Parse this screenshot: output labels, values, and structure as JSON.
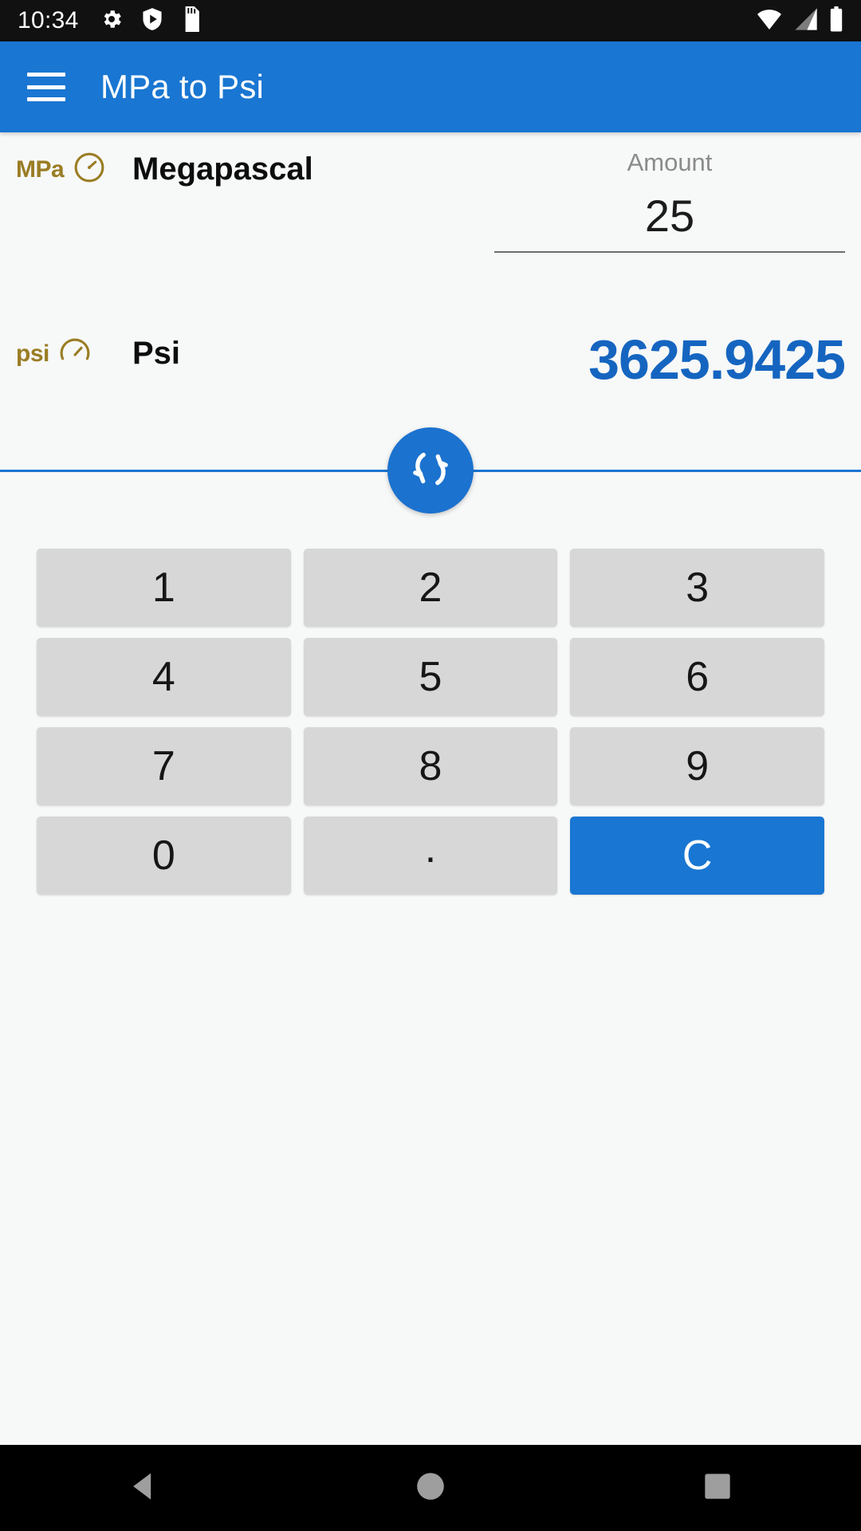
{
  "status_bar": {
    "time": "10:34",
    "left_icons": [
      "gear-icon",
      "shield-play-icon",
      "sd-card-icon"
    ],
    "right_icons": [
      "wifi-icon",
      "cellular-signal-icon",
      "battery-icon"
    ],
    "background": "#111111",
    "foreground": "#ffffff"
  },
  "app_bar": {
    "menu_icon": "hamburger-menu-icon",
    "title": "MPa to Psi",
    "background": "#1976d2",
    "text_color": "#ffffff"
  },
  "converter": {
    "from": {
      "badge_text": "MPa",
      "badge_icon": "pressure-gauge-icon",
      "badge_color": "#9a7d24",
      "unit_name": "Megapascal",
      "amount_label": "Amount",
      "amount_value": "25",
      "amount_placeholder": "Amount"
    },
    "to": {
      "badge_text": "psi",
      "badge_icon": "pressure-gauge-icon",
      "badge_color": "#9a7d24",
      "unit_name": "Psi",
      "result_value": "3625.9425",
      "result_color": "#1565c0"
    },
    "swap_button": {
      "icon": "swap-arrows-icon",
      "background": "#1b72cf",
      "icon_color": "#ffffff"
    },
    "divider_color": "#1976d2"
  },
  "keypad": {
    "keys": [
      {
        "label": "1",
        "name": "key-1",
        "style": "normal"
      },
      {
        "label": "2",
        "name": "key-2",
        "style": "normal"
      },
      {
        "label": "3",
        "name": "key-3",
        "style": "normal"
      },
      {
        "label": "4",
        "name": "key-4",
        "style": "normal"
      },
      {
        "label": "5",
        "name": "key-5",
        "style": "normal"
      },
      {
        "label": "6",
        "name": "key-6",
        "style": "normal"
      },
      {
        "label": "7",
        "name": "key-7",
        "style": "normal"
      },
      {
        "label": "8",
        "name": "key-8",
        "style": "normal"
      },
      {
        "label": "9",
        "name": "key-9",
        "style": "normal"
      },
      {
        "label": "0",
        "name": "key-0",
        "style": "normal"
      },
      {
        "label": ".",
        "name": "key-decimal",
        "style": "dot"
      },
      {
        "label": "C",
        "name": "key-clear",
        "style": "clear"
      }
    ],
    "key_background": "#d7d7d7",
    "clear_background": "#1976d2"
  },
  "nav_bar": {
    "buttons": [
      "back-icon",
      "home-icon",
      "recents-icon"
    ],
    "background": "#000000",
    "icon_color": "#9e9e9e"
  }
}
